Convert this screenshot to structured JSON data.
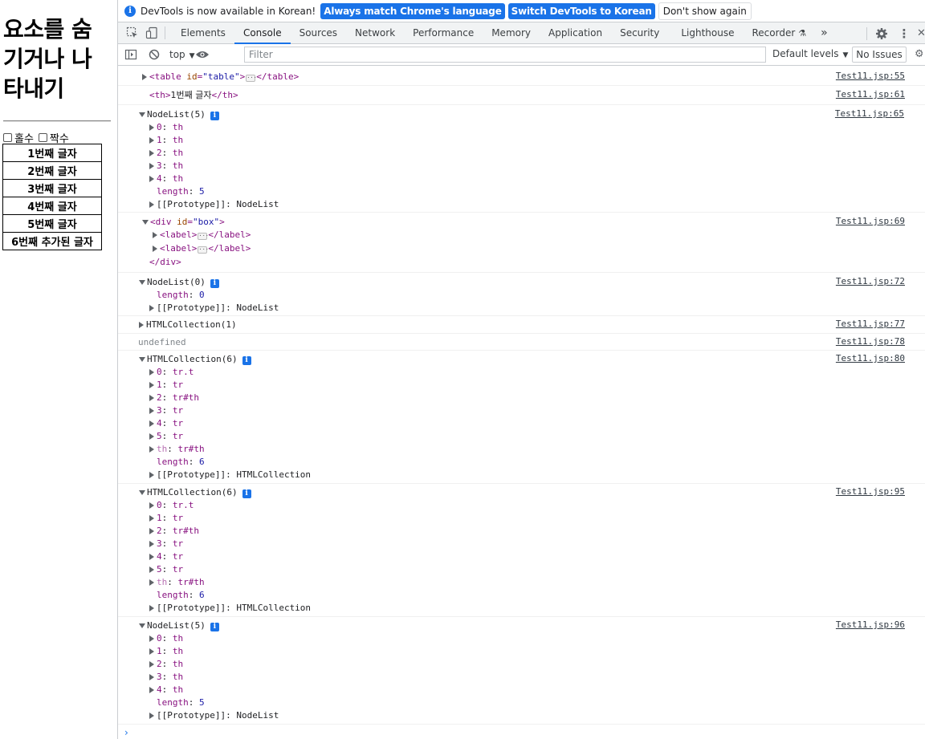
{
  "page": {
    "title": "요소를 숨기거나 나타내기",
    "checkboxes": [
      "홀수",
      "짝수"
    ],
    "table_rows": [
      "1번째 글자",
      "2번째 글자",
      "3번째 글자",
      "4번째 글자",
      "5번째 글자",
      "6번째 추가된 글자"
    ]
  },
  "devtools": {
    "infobar": {
      "message": "DevTools is now available in Korean!",
      "btn_match": "Always match Chrome's language",
      "btn_switch": "Switch DevTools to Korean",
      "btn_dismiss": "Don't show again"
    },
    "tabs": [
      "Elements",
      "Console",
      "Sources",
      "Network",
      "Performance",
      "Memory",
      "Application",
      "Security",
      "Lighthouse",
      "Recorder"
    ],
    "active_tab": "Console",
    "toolbar": {
      "context": "top",
      "filter_placeholder": "Filter",
      "levels": "Default levels",
      "issues": "No Issues"
    },
    "messages": {
      "m1_src": "Test11.jsp:55",
      "m2_src": "Test11.jsp:61",
      "m2_text": "1번째 글자",
      "m3_src": "Test11.jsp:65",
      "m3_head": "NodeList(5)",
      "m4_src": "Test11.jsp:69",
      "m5_src": "Test11.jsp:72",
      "m5_head": "NodeList(0)",
      "m6_src": "Test11.jsp:77",
      "m6_head": "HTMLCollection(1)",
      "m7_src": "Test11.jsp:78",
      "m7_text": "undefined",
      "m8_src": "Test11.jsp:80",
      "m8_head": "HTMLCollection(6)",
      "m9_src": "Test11.jsp:95",
      "m9_head": "HTMLCollection(6)",
      "m10_src": "Test11.jsp:96",
      "m10_head": "NodeList(5)"
    }
  }
}
